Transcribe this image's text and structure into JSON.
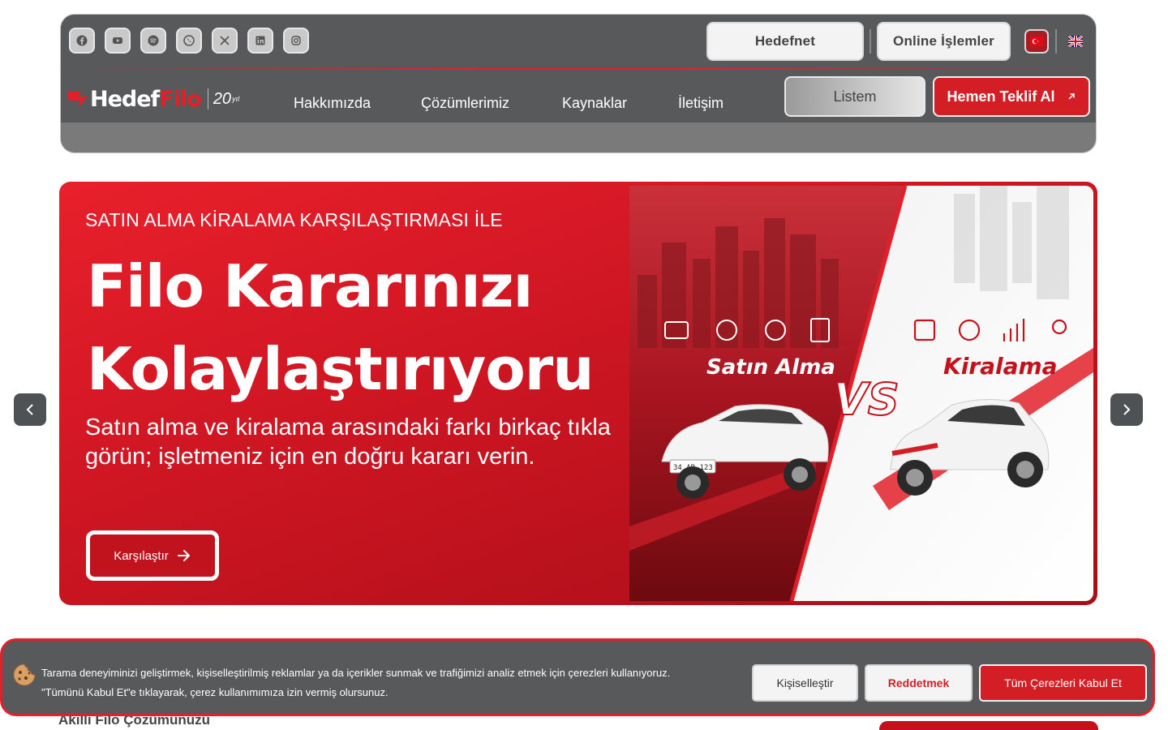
{
  "colors": {
    "brand_red": "#d31e26",
    "dark_gray": "#58595b"
  },
  "header": {
    "social_icons": [
      "facebook-icon",
      "youtube-icon",
      "spotify-icon",
      "whatsapp-icon",
      "x-icon",
      "linkedin-icon",
      "instagram-icon"
    ],
    "hedefnet_label": "Hedefnet",
    "online_label": "Online İşlemler",
    "lang_tr": "turkish-flag-icon",
    "lang_en": "uk-flag-icon",
    "logo": {
      "hedef": "Hedef",
      "filo": "Filo",
      "years": "20",
      "years_suffix": "yıl"
    },
    "nav": [
      "Hakkımızda",
      "Çözümlerimiz",
      "Kaynaklar",
      "İletişim"
    ],
    "listem_label": "Listem",
    "quote_label": "Hemen Teklif Al"
  },
  "hero": {
    "overline": "SATIN ALMA KİRALAMA KARŞILAŞTIRMASI İLE",
    "title_line1": "Filo Kararınızı",
    "title_line2": "Kolaylaştırıyoru",
    "description": "Satın alma ve kiralama arasındaki farkı birkaç tıkla görün; işletmeniz için en doğru kararı verin.",
    "cta_label": "Karşılaştır",
    "image": {
      "left_label": "Satın Alma",
      "right_label": "Kiralama",
      "vs_label": "VS",
      "plate": "34 AB 123"
    }
  },
  "below": {
    "section_title": "Akıllı Filo Çözümünüzü"
  },
  "cookie": {
    "text": "Tarama deneyiminizi geliştirmek, kişiselleştirilmiş reklamlar ya da içerikler sunmak ve trafiğimizi analiz etmek için çerezleri kullanıyoruz. \"Tümünü Kabul Et\"e tıklayarak, çerez kullanımımıza izin vermiş olursunuz.",
    "customize_label": "Kişiselleştir",
    "reject_label": "Reddetmek",
    "accept_label": "Tüm Çerezleri Kabul Et"
  }
}
